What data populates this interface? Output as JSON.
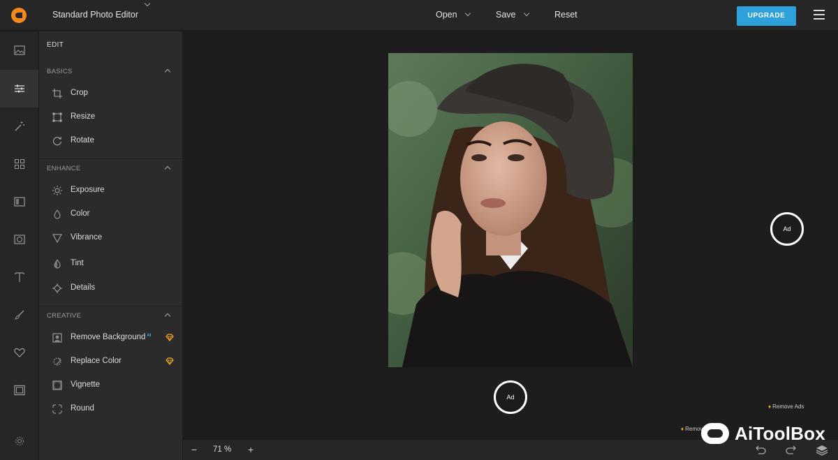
{
  "header": {
    "title": "Standard Photo Editor",
    "menu": [
      "Open",
      "Save",
      "Reset"
    ],
    "upgrade_label": "UPGRADE"
  },
  "rail": {
    "items": [
      "image-icon",
      "adjust-sliders-icon",
      "magic-wand-icon",
      "grid-icon",
      "frame-icon",
      "vignette-icon",
      "text-icon",
      "brush-icon",
      "heart-icon",
      "border-icon",
      "settings-icon"
    ]
  },
  "panel": {
    "heading": "EDIT",
    "basics": {
      "title": "BASICS",
      "items": [
        "Crop",
        "Resize",
        "Rotate"
      ]
    },
    "enhance": {
      "title": "ENHANCE",
      "items": [
        "Exposure",
        "Color",
        "Vibrance",
        "Tint",
        "Details"
      ]
    },
    "creative": {
      "title": "CREATIVE",
      "items": [
        "Remove Background",
        "Replace Color",
        "Vignette",
        "Round"
      ],
      "ai_badge": "AI"
    }
  },
  "canvas": {
    "ad_label": "Ad",
    "remove_ads": "Remove Ads"
  },
  "bottombar": {
    "zoom_minus": "−",
    "zoom": "71 %",
    "zoom_plus": "+"
  },
  "watermark": "AiToolBox",
  "colors": {
    "accent": "#2ea1db",
    "brand": "#f48a1e",
    "premium": "#f5a623"
  }
}
